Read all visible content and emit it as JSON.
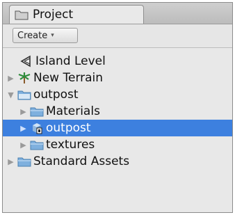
{
  "panel": {
    "tab_title": "Project",
    "toolbar": {
      "create_label": "Create",
      "create_arrow": "▾"
    }
  },
  "tree": {
    "items": [
      {
        "label": "Island Level",
        "icon": "unity-scene-icon",
        "expander": ""
      },
      {
        "label": "New Terrain",
        "icon": "terrain-icon",
        "expander": "▶"
      },
      {
        "label": "outpost",
        "icon": "folder-open-icon",
        "expander": "▼"
      },
      {
        "label": "Materials",
        "icon": "folder-icon",
        "expander": "▶"
      },
      {
        "label": "outpost",
        "icon": "prefab-model-icon",
        "expander": "▶",
        "selected": true
      },
      {
        "label": "textures",
        "icon": "folder-icon",
        "expander": "▶"
      },
      {
        "label": "Standard Assets",
        "icon": "folder-icon",
        "expander": "▶"
      }
    ]
  },
  "colors": {
    "selection": "#3d80df",
    "folder": "#6fa5d8",
    "panel_bg": "#e8e8e8"
  }
}
